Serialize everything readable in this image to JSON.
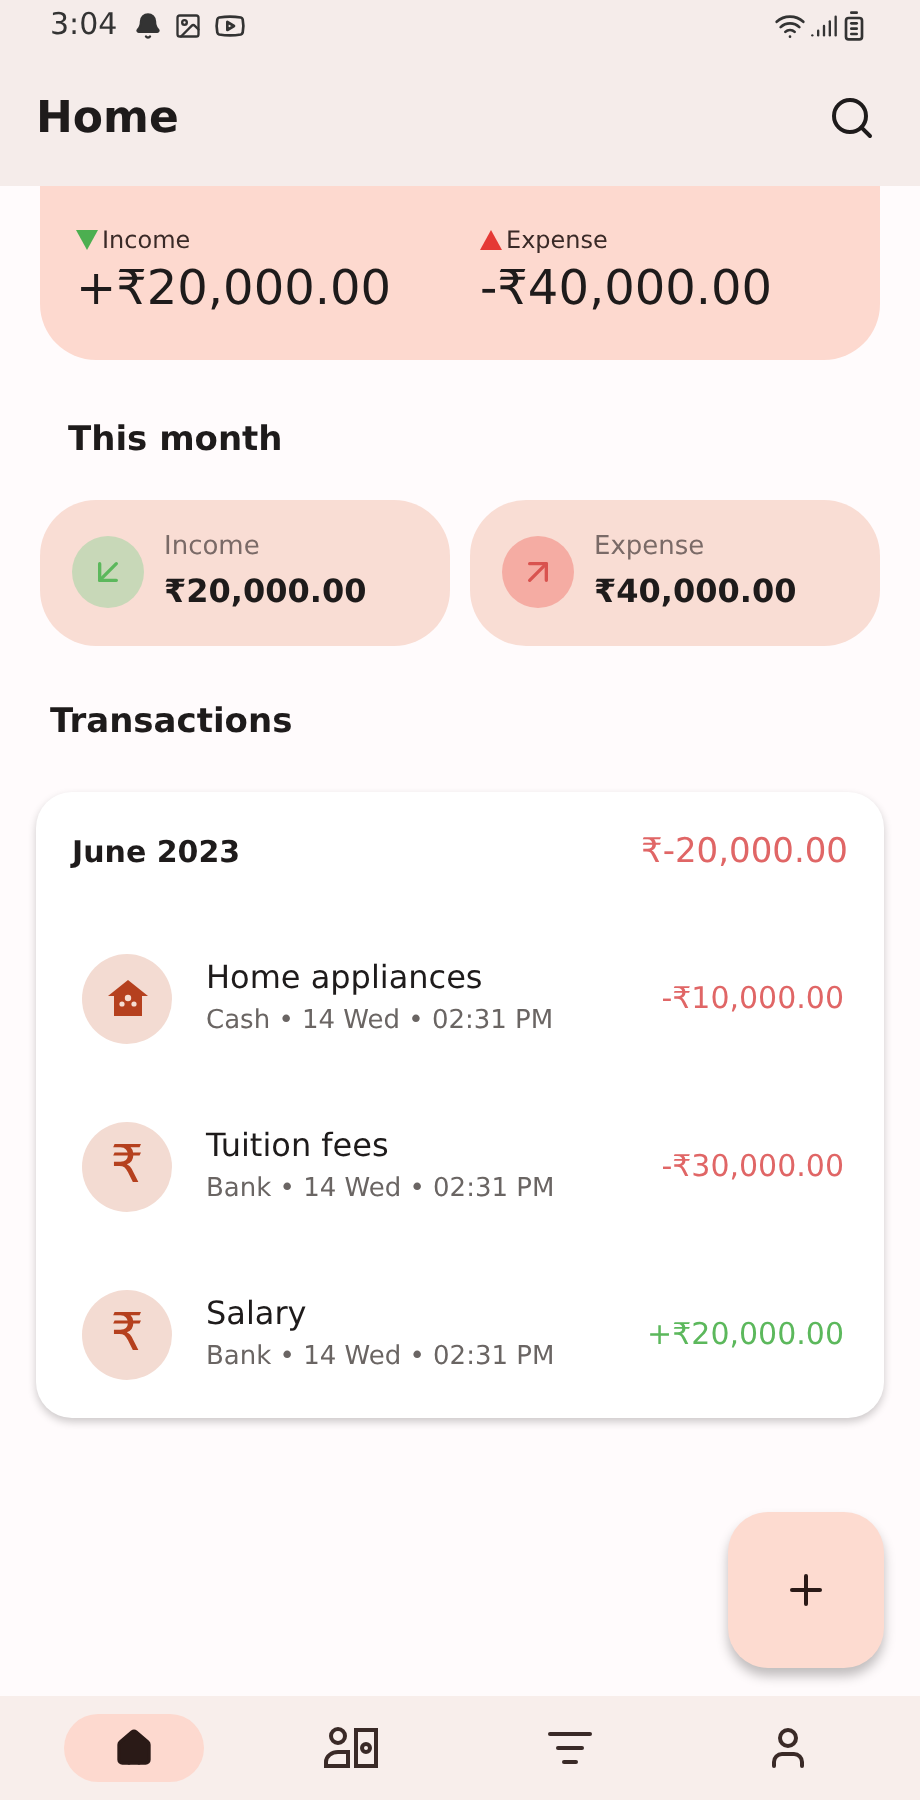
{
  "status_bar": {
    "time": "3:04"
  },
  "header": {
    "title": "Home"
  },
  "total": {
    "income_label": "Income",
    "income": "+₹20,000.00",
    "expense_label": "Expense",
    "expense": "-₹40,000.00"
  },
  "this_month": {
    "title": "This month",
    "cards": [
      {
        "kind": "income",
        "label": "Income",
        "amount": "₹20,000.00"
      },
      {
        "kind": "expense",
        "label": "Expense",
        "amount": "₹40,000.00"
      }
    ]
  },
  "transactions": {
    "title": "Transactions",
    "month": "June 2023",
    "month_total": "₹-20,000.00",
    "items": [
      {
        "kind": "expense",
        "name": "Home appliances",
        "meta": "Cash • 14 Wed • 02:31 PM",
        "amount": "-₹10,000.00"
      },
      {
        "symbol": "₹",
        "kind": "expense",
        "name": "Tuition fees",
        "meta": "Bank • 14 Wed • 02:31 PM",
        "amount": "-₹30,000.00"
      },
      {
        "symbol": "₹",
        "kind": "income",
        "name": "Salary",
        "meta": "Bank • 14 Wed • 02:31 PM",
        "amount": "+₹20,000.00"
      }
    ]
  },
  "nav": [
    {
      "selected": true
    },
    {
      "selected": false
    },
    {
      "selected": false
    },
    {
      "selected": false
    }
  ]
}
